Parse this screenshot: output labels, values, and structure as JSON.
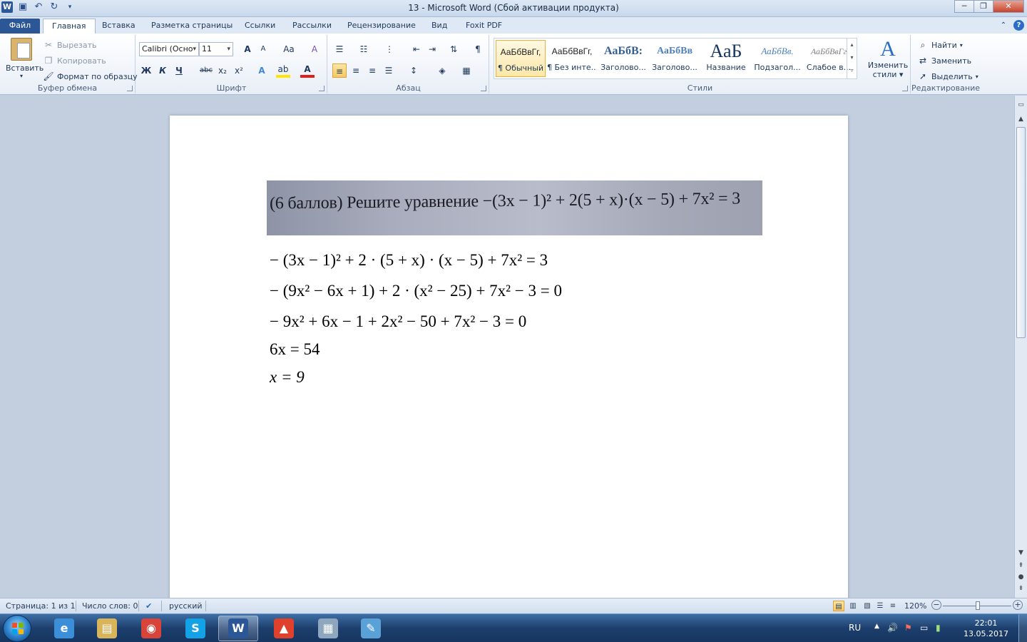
{
  "window": {
    "title": "13  -  Microsoft Word (Сбой активации продукта)",
    "app_logo_letter": "W",
    "minimize": "─",
    "restore": "❐",
    "close": "✕"
  },
  "tabs": [
    {
      "label": "Файл"
    },
    {
      "label": "Главная"
    },
    {
      "label": "Вставка"
    },
    {
      "label": "Разметка страницы"
    },
    {
      "label": "Ссылки"
    },
    {
      "label": "Рассылки"
    },
    {
      "label": "Рецензирование"
    },
    {
      "label": "Вид"
    },
    {
      "label": "Foxit PDF"
    }
  ],
  "ribbon": {
    "clipboard": {
      "label": "Буфер обмена",
      "paste": "Вставить",
      "cut": "Вырезать",
      "copy": "Копировать",
      "format_painter": "Формат по образцу"
    },
    "font": {
      "label": "Шрифт",
      "font_name": "Calibri (Осно",
      "font_size": "11",
      "grow": "A",
      "shrink": "A",
      "change_case": "Aa",
      "clear": "A",
      "bold": "Ж",
      "italic": "К",
      "underline": "Ч",
      "strike": "abc",
      "subscript": "x₂",
      "superscript": "x²",
      "effects": "A",
      "highlight": "ab",
      "font_color": "A"
    },
    "paragraph": {
      "label": "Абзац",
      "show_marks": "¶"
    },
    "styles": {
      "label": "Стили",
      "items": [
        {
          "preview": "АаБбВвГг,",
          "name": "¶ Обычный"
        },
        {
          "preview": "АаБбВвГг,",
          "name": "¶ Без инте..."
        },
        {
          "preview": "АаБбВ:",
          "name": "Заголово..."
        },
        {
          "preview": "АаБбВв",
          "name": "Заголово..."
        },
        {
          "preview": "АаБ",
          "name": "Название"
        },
        {
          "preview": "АаБбВв.",
          "name": "Подзагол..."
        },
        {
          "preview": "АаБбВвГг",
          "name": "Слабое в..."
        }
      ],
      "change_styles_line1": "Изменить",
      "change_styles_line2": "стили ▾"
    },
    "editing": {
      "label": "Редактирование",
      "find": "Найти",
      "replace": "Заменить",
      "select": "Выделить"
    }
  },
  "document": {
    "photo_text": "(6 баллов) Решите уравнение −(3x − 1)² + 2(5 + x)·(x − 5) + 7x² = 3",
    "equations": [
      "− (3x − 1)² + 2 · (5 + x) · (x − 5) + 7x² = 3",
      "− (9x² − 6x + 1) + 2 · (x² − 25) + 7x² − 3 = 0",
      "− 9x² + 6x − 1 + 2x² − 50 + 7x² − 3 = 0",
      "6x = 54",
      "x = 9"
    ]
  },
  "status": {
    "page": "Страница: 1 из 1",
    "words": "Число слов: 0",
    "language": "русский",
    "zoom": "120%",
    "zoom_minus": "−",
    "zoom_plus": "+"
  },
  "taskbar": {
    "apps": [
      {
        "name": "ie",
        "glyph": "e",
        "color": "#3a8fd8"
      },
      {
        "name": "explorer",
        "glyph": "▤",
        "color": "#d8b45a"
      },
      {
        "name": "chrome",
        "glyph": "◉",
        "color": "#d9443a"
      },
      {
        "name": "skype",
        "glyph": "S",
        "color": "#14a2e6"
      },
      {
        "name": "word",
        "glyph": "W",
        "color": "#2b5797"
      },
      {
        "name": "app-triangle",
        "glyph": "▲",
        "color": "#e0412c"
      },
      {
        "name": "calculator",
        "glyph": "▦",
        "color": "#8fa6bf"
      },
      {
        "name": "paint",
        "glyph": "✎",
        "color": "#5aa1d8"
      }
    ],
    "language": "RU",
    "time": "22:01",
    "date": "13.05.2017"
  }
}
